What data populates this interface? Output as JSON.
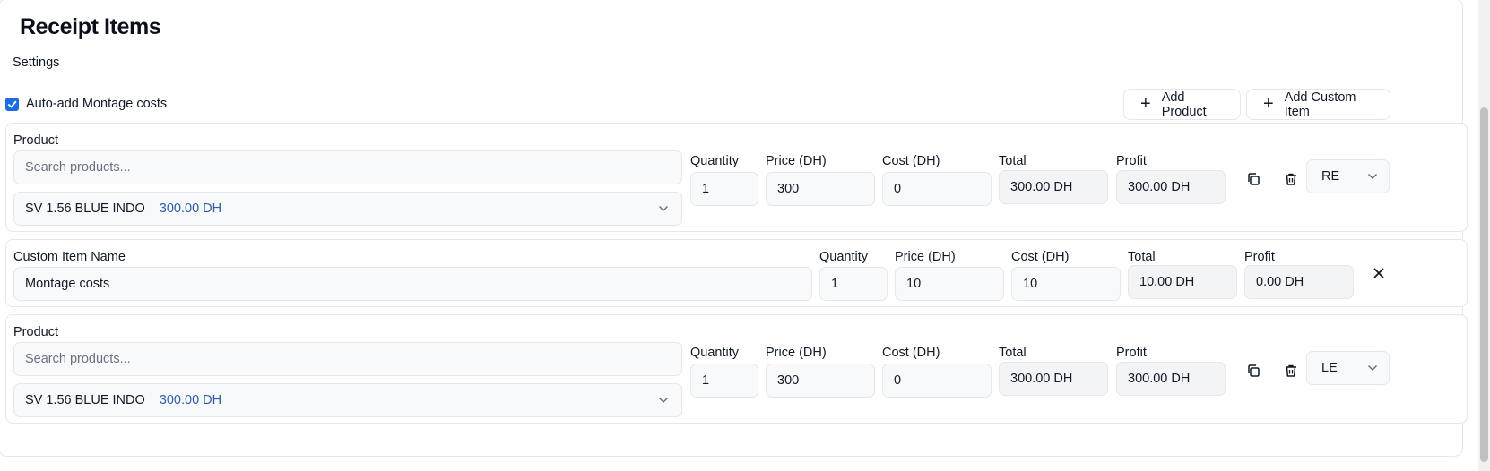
{
  "header": {
    "title": "Receipt Items",
    "settings_label": "Settings"
  },
  "options": {
    "auto_add_label": "Auto-add Montage costs",
    "auto_add_checked": true
  },
  "toolbar": {
    "add_product_label": "Add Product",
    "add_custom_label": "Add Custom Item"
  },
  "labels": {
    "product": "Product",
    "custom_item_name": "Custom Item Name",
    "quantity": "Quantity",
    "price": "Price (DH)",
    "cost": "Cost (DH)",
    "total": "Total",
    "profit": "Profit"
  },
  "search_placeholder": "Search products...",
  "items": [
    {
      "product_name": "SV 1.56 BLUE INDO",
      "product_price": "300.00 DH",
      "quantity": "1",
      "price": "300",
      "cost": "0",
      "total": "300.00 DH",
      "profit": "300.00 DH",
      "eye": "RE"
    },
    {
      "name": "Montage costs",
      "quantity": "1",
      "price": "10",
      "cost": "10",
      "total": "10.00 DH",
      "profit": "0.00 DH"
    },
    {
      "product_name": "SV 1.56 BLUE INDO",
      "product_price": "300.00 DH",
      "quantity": "1",
      "price": "300",
      "cost": "0",
      "total": "300.00 DH",
      "profit": "300.00 DH",
      "eye": "LE"
    }
  ],
  "icons": {
    "checkbox": "check-icon",
    "add": "plus-icon",
    "duplicate": "copy-icon",
    "delete": "trash-icon",
    "remove": "close-icon",
    "dropdown": "chevron-down-icon"
  },
  "colors": {
    "accent": "#1d6ce6",
    "price_text": "#2f5dab"
  }
}
